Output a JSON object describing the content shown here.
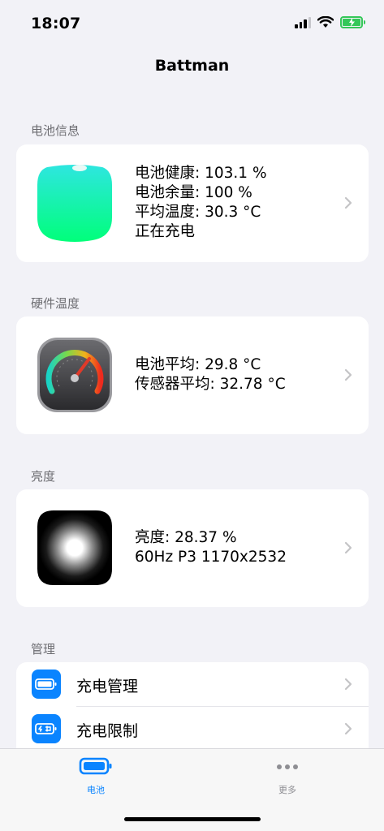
{
  "status_bar": {
    "time": "18:07",
    "icons": [
      "cellular-signal-icon",
      "wifi-icon",
      "battery-charging-icon"
    ],
    "battery_color": "#34c759"
  },
  "nav": {
    "title": "Battman"
  },
  "sections": {
    "battery_info": {
      "header": "电池信息",
      "icon": "battery-blob-icon",
      "lines": [
        "电池健康: 103.1 %",
        "电池余量: 100 %",
        "平均温度: 30.3 °C",
        "正在充电"
      ]
    },
    "hardware_temp": {
      "header": "硬件温度",
      "icon": "gauge-icon",
      "lines": [
        "电池平均: 29.8 °C",
        "传感器平均: 32.78 °C"
      ]
    },
    "brightness": {
      "header": "亮度",
      "icon": "brightness-glow-icon",
      "lines": [
        "亮度: 28.37 %",
        "60Hz P3 1170x2532"
      ]
    },
    "management": {
      "header": "管理",
      "items": [
        {
          "label": "充电管理",
          "icon": "battery-full-icon"
        },
        {
          "label": "充电限制",
          "icon": "battery-limit-icon"
        }
      ]
    }
  },
  "tab_bar": {
    "tabs": [
      {
        "label": "电池",
        "icon": "battery-tab-icon",
        "active": true
      },
      {
        "label": "更多",
        "icon": "more-dots-icon",
        "active": false
      }
    ],
    "accent": "#0a84ff",
    "inactive": "#8e8e93"
  }
}
